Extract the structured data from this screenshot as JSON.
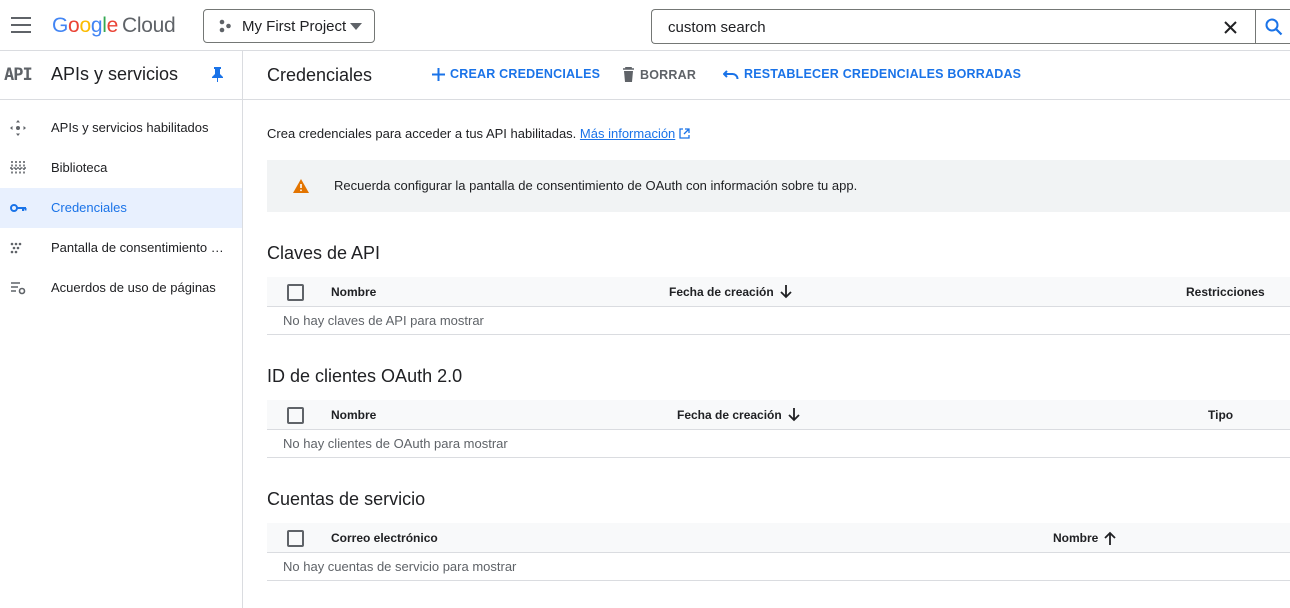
{
  "topbar": {
    "logo_google": "Google",
    "logo_cloud": "Cloud",
    "project_name": "My First Project",
    "search_value": "custom search"
  },
  "sidebar": {
    "badge": "API",
    "title": "APIs y servicios",
    "items": [
      {
        "label": "APIs y servicios habilitados",
        "icon": "apis-services-icon"
      },
      {
        "label": "Biblioteca",
        "icon": "library-icon"
      },
      {
        "label": "Credenciales",
        "icon": "key-icon",
        "active": true
      },
      {
        "label": "Pantalla de consentimiento de OAuth",
        "icon": "oauth-consent-icon"
      },
      {
        "label": "Acuerdos de uso de páginas",
        "icon": "page-agreements-icon"
      }
    ]
  },
  "main": {
    "title": "Credenciales",
    "actions": {
      "create": "CREAR CREDENCIALES",
      "delete": "BORRAR",
      "restore": "RESTABLECER CREDENCIALES BORRADAS"
    },
    "intro_text": "Crea credenciales para acceder a tus API habilitadas.",
    "intro_link": "Más información",
    "callout": "Recuerda configurar la pantalla de consentimiento de OAuth con información sobre tu app.",
    "sections": [
      {
        "title": "Claves de API",
        "headers": [
          "Nombre",
          "Fecha de creación",
          "Restricciones"
        ],
        "empty": "No hay claves de API para mostrar"
      },
      {
        "title": "ID de clientes OAuth 2.0",
        "headers": [
          "Nombre",
          "Fecha de creación",
          "Tipo"
        ],
        "empty": "No hay clientes de OAuth para mostrar"
      },
      {
        "title": "Cuentas de servicio",
        "headers": [
          "Correo electrónico",
          "Nombre"
        ],
        "empty": "No hay cuentas de servicio para mostrar"
      }
    ]
  },
  "colors": {
    "accent": "#1a73e8",
    "warning": "#e37400",
    "active_bg": "#e8f0fe"
  }
}
